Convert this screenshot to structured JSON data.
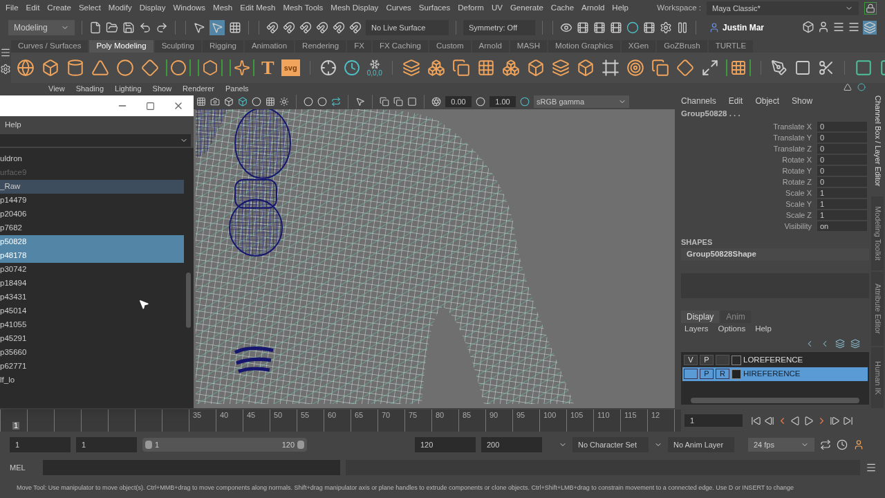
{
  "menu_bar": {
    "items": [
      "File",
      "Edit",
      "Create",
      "Select",
      "Modify",
      "Display",
      "Windows",
      "Mesh",
      "Edit Mesh",
      "Mesh Tools",
      "Mesh Display",
      "Curves",
      "Surfaces",
      "Deform",
      "UV",
      "Generate",
      "Cache",
      "Arnold",
      "Help"
    ],
    "workspace_label": "Workspace :",
    "workspace": "Maya Classic*"
  },
  "status_line": {
    "mode": "Modeling",
    "live_surface": "No Live Surface",
    "symmetry": "Symmetry: Off",
    "user": "Justin Mar"
  },
  "shelf": {
    "tabs": [
      {
        "label": "Curves / Surfaces",
        "selected": false
      },
      {
        "label": "Poly Modeling",
        "selected": true
      },
      {
        "label": "Sculpting",
        "selected": false
      },
      {
        "label": "Rigging",
        "selected": false
      },
      {
        "label": "Animation",
        "selected": false
      },
      {
        "label": "Rendering",
        "selected": false
      },
      {
        "label": "FX",
        "selected": false
      },
      {
        "label": "FX Caching",
        "selected": false
      },
      {
        "label": "Custom",
        "selected": false
      },
      {
        "label": "Arnold",
        "selected": false
      },
      {
        "label": "MASH",
        "selected": false
      },
      {
        "label": "Motion Graphics",
        "selected": false
      },
      {
        "label": "XGen",
        "selected": false
      },
      {
        "label": "GoZBrush",
        "selected": false
      },
      {
        "label": "TURTLE",
        "selected": false
      }
    ],
    "text_icon": "T",
    "svg_icon": "svg",
    "origin_label": "0,0,0"
  },
  "viewport": {
    "menus": [
      "View",
      "Shading",
      "Lighting",
      "Show",
      "Renderer",
      "Panels"
    ],
    "exposure": "0.00",
    "gamma": "1.00",
    "color_space": "sRGB gamma"
  },
  "outliner": {
    "menus": [
      "Help"
    ],
    "items": [
      {
        "label": "uldron",
        "selected": false,
        "highlighted": false,
        "greyed": false
      },
      {
        "label": "urface9",
        "selected": false,
        "highlighted": false,
        "greyed": true
      },
      {
        "label": "_Raw",
        "selected": false,
        "highlighted": true,
        "greyed": false
      },
      {
        "label": "p14479",
        "selected": false,
        "highlighted": false,
        "greyed": false
      },
      {
        "label": "p20406",
        "selected": false,
        "highlighted": false,
        "greyed": false
      },
      {
        "label": "p7682",
        "selected": false,
        "highlighted": false,
        "greyed": false
      },
      {
        "label": "p50828",
        "selected": true,
        "highlighted": false,
        "greyed": false
      },
      {
        "label": "p48178",
        "selected": true,
        "highlighted": false,
        "greyed": false
      },
      {
        "label": "p30742",
        "selected": false,
        "highlighted": false,
        "greyed": false
      },
      {
        "label": "p18494",
        "selected": false,
        "highlighted": false,
        "greyed": false
      },
      {
        "label": "p43431",
        "selected": false,
        "highlighted": false,
        "greyed": false
      },
      {
        "label": "p45014",
        "selected": false,
        "highlighted": false,
        "greyed": false
      },
      {
        "label": "p41055",
        "selected": false,
        "highlighted": false,
        "greyed": false
      },
      {
        "label": "p45291",
        "selected": false,
        "highlighted": false,
        "greyed": false
      },
      {
        "label": "p35660",
        "selected": false,
        "highlighted": false,
        "greyed": false
      },
      {
        "label": "p62771",
        "selected": false,
        "highlighted": false,
        "greyed": false
      },
      {
        "label": "lf_lo",
        "selected": false,
        "highlighted": false,
        "greyed": false
      }
    ]
  },
  "channel_box": {
    "menus": [
      "Channels",
      "Edit",
      "Object",
      "Show"
    ],
    "object": "Group50828 . . .",
    "channels": [
      {
        "name": "Translate X",
        "value": "0"
      },
      {
        "name": "Translate Y",
        "value": "0"
      },
      {
        "name": "Translate Z",
        "value": "0"
      },
      {
        "name": "Rotate X",
        "value": "0"
      },
      {
        "name": "Rotate Y",
        "value": "0"
      },
      {
        "name": "Rotate Z",
        "value": "0"
      },
      {
        "name": "Scale X",
        "value": "1"
      },
      {
        "name": "Scale Y",
        "value": "1"
      },
      {
        "name": "Scale Z",
        "value": "1"
      },
      {
        "name": "Visibility",
        "value": "on"
      }
    ],
    "shapes_heading": "SHAPES",
    "shape": "Group50828Shape"
  },
  "layer_editor": {
    "tabs": [
      {
        "label": "Display",
        "selected": true
      },
      {
        "label": "Anim",
        "selected": false
      }
    ],
    "menus": [
      "Layers",
      "Options",
      "Help"
    ],
    "layers": [
      {
        "name": "LOREFERENCE",
        "v": "V",
        "p": "P",
        "selected": false
      },
      {
        "name": "HIREFERENCE",
        "p": "P",
        "r": "R",
        "selected": true
      }
    ]
  },
  "side_tabs": [
    {
      "label": "Channel Box / Layer Editor",
      "selected": true
    },
    {
      "label": "Modeling Toolkit",
      "selected": false
    },
    {
      "label": "Attribute Editor",
      "selected": false
    },
    {
      "label": "Human IK",
      "selected": false
    }
  ],
  "time_slider": {
    "start_label": "1",
    "tick_labels": [
      "35",
      "40",
      "45",
      "50",
      "55",
      "60",
      "65",
      "70",
      "75",
      "80",
      "85",
      "90",
      "95",
      "100",
      "105",
      "110",
      "115",
      "12"
    ],
    "current_frame": "1",
    "level": 0
  },
  "range": {
    "start": "1",
    "playback_start": "1",
    "slider_start": "1",
    "slider_end": "120",
    "playback_end": "120",
    "end": "200",
    "character_set": "No Character Set",
    "anim_layer": "No Anim Layer",
    "fps": "24 fps",
    "level": 1
  },
  "command_line": {
    "label": "MEL"
  },
  "help_line": "Move Tool: Use manipulator to move object(s). Ctrl+MMB+drag to move components along normals. Shift+drag manipulator axis or plane handles to extrude components or clone objects. Ctrl+Shift+LMB+drag to constrain movement to a connected edge. Use D or INSERT to change"
}
